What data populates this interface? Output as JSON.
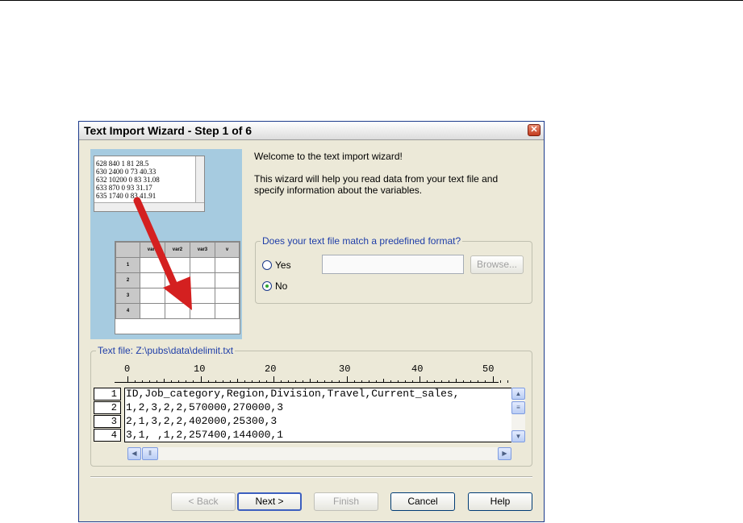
{
  "window": {
    "title": "Text Import Wizard - Step 1 of 6"
  },
  "illustration": {
    "sample_lines": [
      "628 840 1 81 28.5",
      "630 2400 0 73 40.33",
      "632 10200 0 83 31.08",
      "633 870 0 93 31.17",
      "635 1740 0 83 41.91"
    ],
    "grid_headers": [
      "var1",
      "var2",
      "var3",
      "v"
    ],
    "grid_rows": [
      "1",
      "2",
      "3",
      "4"
    ]
  },
  "welcome": {
    "line1": "Welcome to the text import wizard!",
    "line2": "This wizard will help you read data from your text file and specify information about the variables."
  },
  "format_group": {
    "legend": "Does your text file match a predefined format?",
    "yes_label": "Yes",
    "no_label": "No",
    "selected": "No",
    "path_value": "",
    "browse_label": "Browse..."
  },
  "text_file": {
    "legend": "Text file: Z:\\pubs\\data\\delimit.txt",
    "ruler": [
      "0",
      "10",
      "20",
      "30",
      "40",
      "50"
    ],
    "rows": [
      {
        "num": "1",
        "text": "ID,Job_category,Region,Division,Travel,Current_sales,"
      },
      {
        "num": "2",
        "text": "1,2,3,2,2,570000,270000,3"
      },
      {
        "num": "3",
        "text": "2,1,3,2,2,402000,25300,3"
      },
      {
        "num": "4",
        "text": "3,1, ,1,2,257400,144000,1"
      }
    ]
  },
  "buttons": {
    "back": "< Back",
    "next": "Next >",
    "finish": "Finish",
    "cancel": "Cancel",
    "help": "Help"
  },
  "icons": {
    "close": "close-icon",
    "scroll_up": "arrow-up-icon",
    "scroll_down": "arrow-down-icon",
    "scroll_left": "arrow-left-icon",
    "scroll_right": "arrow-right-icon"
  }
}
